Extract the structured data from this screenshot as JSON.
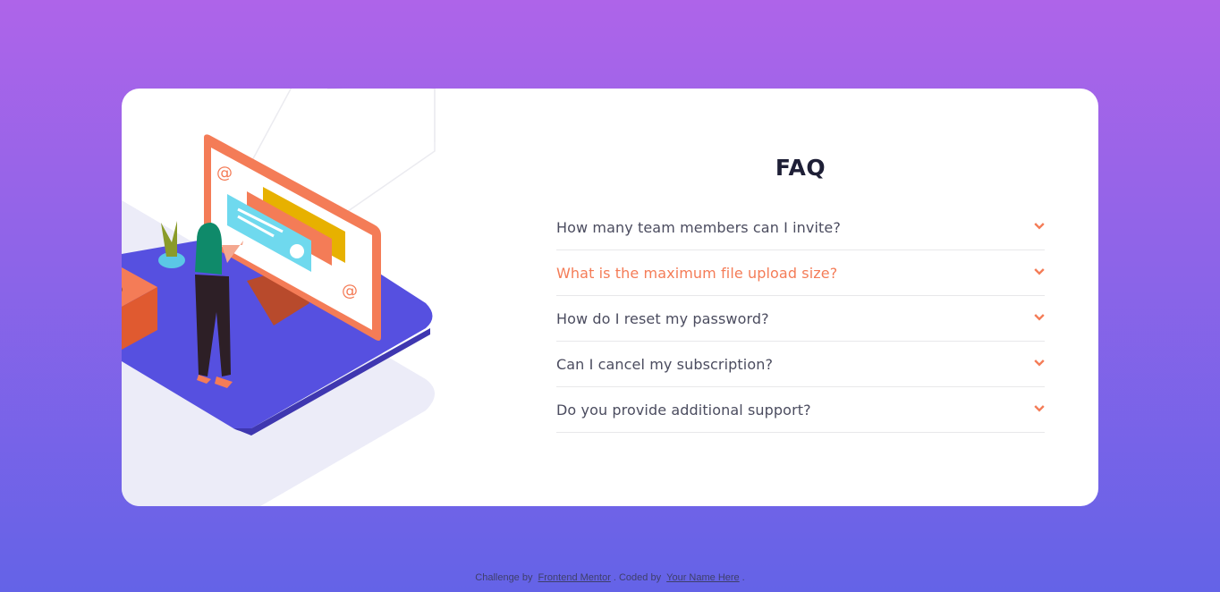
{
  "faq": {
    "title": "FAQ",
    "items": [
      {
        "question": "How many team members can I invite?",
        "active": false
      },
      {
        "question": "What is the maximum file upload size?",
        "active": true
      },
      {
        "question": "How do I reset my password?",
        "active": false
      },
      {
        "question": "Can I cancel my subscription?",
        "active": false
      },
      {
        "question": "Do you provide additional support?",
        "active": false
      }
    ]
  },
  "footer": {
    "prefix": "Challenge by",
    "mentor_link": "Frontend Mentor",
    "middle": ". Coded by",
    "author_link": "Your Name Here",
    "suffix": "."
  },
  "colors": {
    "bg_top": "#ae64e9",
    "bg_bottom": "#6463e7",
    "accent": "#f47c57",
    "title": "#1e1f36",
    "text": "#4b4c5f",
    "divider": "#e8e8ea"
  },
  "icons": [
    "chevron-down-icon",
    "at-sign-icon"
  ]
}
